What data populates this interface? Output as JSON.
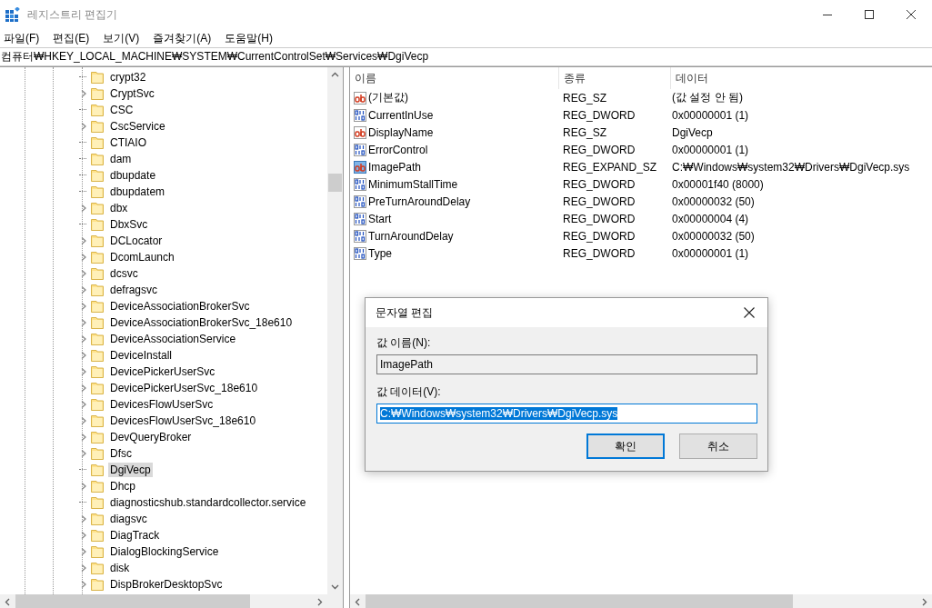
{
  "window": {
    "title": "레지스트리 편집기"
  },
  "menu": [
    "파일(F)",
    "편집(E)",
    "보기(V)",
    "즐겨찾기(A)",
    "도움말(H)"
  ],
  "address": "컴퓨터₩HKEY_LOCAL_MACHINE₩SYSTEM₩CurrentControlSet₩Services₩DgiVecp",
  "tree": [
    {
      "label": "crypt32",
      "expandable": false,
      "selected": false
    },
    {
      "label": "CryptSvc",
      "expandable": true,
      "selected": false
    },
    {
      "label": "CSC",
      "expandable": false,
      "selected": false
    },
    {
      "label": "CscService",
      "expandable": true,
      "selected": false
    },
    {
      "label": "CTIAIO",
      "expandable": false,
      "selected": false
    },
    {
      "label": "dam",
      "expandable": false,
      "selected": false
    },
    {
      "label": "dbupdate",
      "expandable": false,
      "selected": false
    },
    {
      "label": "dbupdatem",
      "expandable": false,
      "selected": false
    },
    {
      "label": "dbx",
      "expandable": true,
      "selected": false
    },
    {
      "label": "DbxSvc",
      "expandable": false,
      "selected": false
    },
    {
      "label": "DCLocator",
      "expandable": true,
      "selected": false
    },
    {
      "label": "DcomLaunch",
      "expandable": true,
      "selected": false
    },
    {
      "label": "dcsvc",
      "expandable": true,
      "selected": false
    },
    {
      "label": "defragsvc",
      "expandable": true,
      "selected": false
    },
    {
      "label": "DeviceAssociationBrokerSvc",
      "expandable": true,
      "selected": false
    },
    {
      "label": "DeviceAssociationBrokerSvc_18e610",
      "expandable": true,
      "selected": false
    },
    {
      "label": "DeviceAssociationService",
      "expandable": true,
      "selected": false
    },
    {
      "label": "DeviceInstall",
      "expandable": true,
      "selected": false
    },
    {
      "label": "DevicePickerUserSvc",
      "expandable": true,
      "selected": false
    },
    {
      "label": "DevicePickerUserSvc_18e610",
      "expandable": true,
      "selected": false
    },
    {
      "label": "DevicesFlowUserSvc",
      "expandable": true,
      "selected": false
    },
    {
      "label": "DevicesFlowUserSvc_18e610",
      "expandable": true,
      "selected": false
    },
    {
      "label": "DevQueryBroker",
      "expandable": true,
      "selected": false
    },
    {
      "label": "Dfsc",
      "expandable": true,
      "selected": false
    },
    {
      "label": "DgiVecp",
      "expandable": false,
      "selected": true
    },
    {
      "label": "Dhcp",
      "expandable": true,
      "selected": false
    },
    {
      "label": "diagnosticshub.standardcollector.service",
      "expandable": false,
      "selected": false
    },
    {
      "label": "diagsvc",
      "expandable": true,
      "selected": false
    },
    {
      "label": "DiagTrack",
      "expandable": true,
      "selected": false
    },
    {
      "label": "DialogBlockingService",
      "expandable": true,
      "selected": false
    },
    {
      "label": "disk",
      "expandable": true,
      "selected": false
    },
    {
      "label": "DispBrokerDesktopSvc",
      "expandable": true,
      "selected": false
    }
  ],
  "values": {
    "columns": [
      "이름",
      "종류",
      "데이터"
    ],
    "rows": [
      {
        "kind": "string",
        "name": "(기본값)",
        "type": "REG_SZ",
        "data": "(값 설정 안 됨)"
      },
      {
        "kind": "dword",
        "name": "CurrentInUse",
        "type": "REG_DWORD",
        "data": "0x00000001 (1)"
      },
      {
        "kind": "string",
        "name": "DisplayName",
        "type": "REG_SZ",
        "data": "DgiVecp"
      },
      {
        "kind": "dword",
        "name": "ErrorControl",
        "type": "REG_DWORD",
        "data": "0x00000001 (1)"
      },
      {
        "kind": "expand",
        "name": "ImagePath",
        "type": "REG_EXPAND_SZ",
        "data": "C:₩Windows₩system32₩Drivers₩DgiVecp.sys"
      },
      {
        "kind": "dword",
        "name": "MinimumStallTime",
        "type": "REG_DWORD",
        "data": "0x00001f40 (8000)"
      },
      {
        "kind": "dword",
        "name": "PreTurnAroundDelay",
        "type": "REG_DWORD",
        "data": "0x00000032 (50)"
      },
      {
        "kind": "dword",
        "name": "Start",
        "type": "REG_DWORD",
        "data": "0x00000004 (4)"
      },
      {
        "kind": "dword",
        "name": "TurnAroundDelay",
        "type": "REG_DWORD",
        "data": "0x00000032 (50)"
      },
      {
        "kind": "dword",
        "name": "Type",
        "type": "REG_DWORD",
        "data": "0x00000001 (1)"
      }
    ]
  },
  "dialog": {
    "title": "문자열 편집",
    "name_label": "값 이름(N):",
    "name_value": "ImagePath",
    "data_label": "값 데이터(V):",
    "data_value": "C:₩Windows₩system32₩Drivers₩DgiVecp.sys",
    "data_selected": true,
    "buttons": [
      {
        "label": "확인",
        "default": true
      },
      {
        "label": "취소",
        "default": false
      }
    ]
  }
}
